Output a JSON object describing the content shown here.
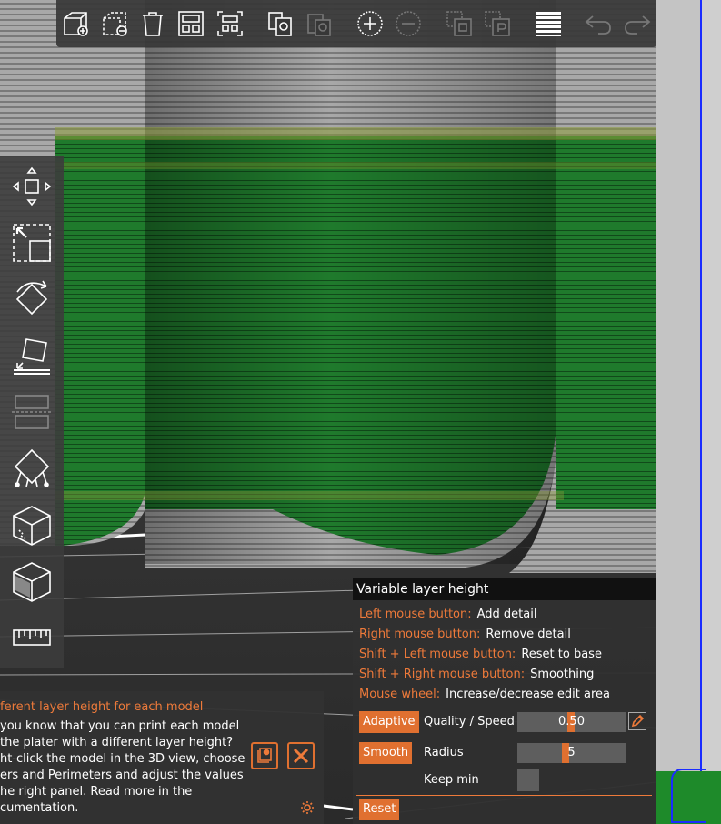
{
  "viewport": {
    "colors": {
      "green_band": "#1f7a2c",
      "stripe_gray": "#9a9a9a",
      "accent": "#e07030"
    }
  },
  "top_toolbar": {
    "icons": [
      "add-object-icon",
      "delete-object-icon",
      "delete-all-icon",
      "arrange-icon",
      "arrange-selection-icon",
      "copy-icon",
      "paste-icon",
      "add-instance-icon",
      "remove-instance-icon",
      "split-objects-icon",
      "split-parts-icon",
      "layer-editing-icon",
      "undo-icon",
      "redo-icon"
    ]
  },
  "left_toolbar": {
    "icons": [
      "move-icon",
      "scale-icon",
      "rotate-icon",
      "place-on-face-icon",
      "cut-icon",
      "support-points-icon",
      "seam-painting-icon",
      "mmu-painting-icon",
      "measure-icon"
    ]
  },
  "variable_layer_height": {
    "title": "Variable layer height",
    "hints": [
      {
        "key": "Left mouse button:",
        "value": "Add detail"
      },
      {
        "key": "Right mouse button:",
        "value": "Remove detail"
      },
      {
        "key": "Shift + Left mouse button:",
        "value": "Reset to base"
      },
      {
        "key": "Shift + Right mouse button:",
        "value": "Smoothing"
      },
      {
        "key": "Mouse wheel:",
        "value": "Increase/decrease edit area"
      }
    ],
    "adaptive_label": "Adaptive",
    "quality_label": "Quality / Speed",
    "quality_value": "0.50",
    "smooth_label": "Smooth",
    "radius_label": "Radius",
    "radius_value": "5",
    "keep_min_label": "Keep min",
    "reset_label": "Reset"
  },
  "hint_notification": {
    "title": "ferent layer height for each model",
    "lines": [
      " you know that you can print each model",
      "the plater with a different layer height?",
      "ht-click the model in the 3D view, choose",
      "ers and Perimeters and adjust the values",
      "he right panel. Read more in the",
      "cumentation."
    ]
  }
}
